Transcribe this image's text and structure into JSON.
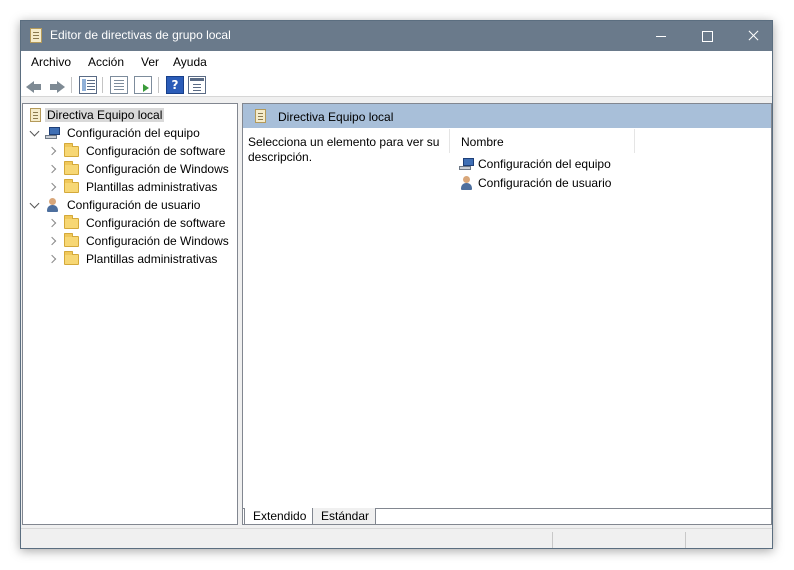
{
  "window": {
    "title": "Editor de directivas de grupo local",
    "controls": [
      "minimize",
      "maximize",
      "close"
    ]
  },
  "menu": [
    "Archivo",
    "Acción",
    "Ver",
    "Ayuda"
  ],
  "toolbar": {
    "icons": [
      "back-arrow-icon",
      "forward-arrow-icon",
      "show-hide-tree-icon",
      "properties-icon",
      "export-list-icon",
      "help-icon",
      "view-icon"
    ]
  },
  "tree": {
    "root": "Directiva Equipo local",
    "nodes": [
      {
        "label": "Configuración del equipo",
        "expanded": true,
        "children": [
          "Configuración de software",
          "Configuración de Windows",
          "Plantillas administrativas"
        ]
      },
      {
        "label": "Configuración de usuario",
        "expanded": true,
        "children": [
          "Configuración de software",
          "Configuración de Windows",
          "Plantillas administrativas"
        ]
      }
    ]
  },
  "details": {
    "header": "Directiva Equipo local",
    "description": "Selecciona un elemento para ver su descripción.",
    "column": "Nombre",
    "items": [
      "Configuración del equipo",
      "Configuración de usuario"
    ]
  },
  "tabs": [
    "Extendido",
    "Estándar"
  ]
}
